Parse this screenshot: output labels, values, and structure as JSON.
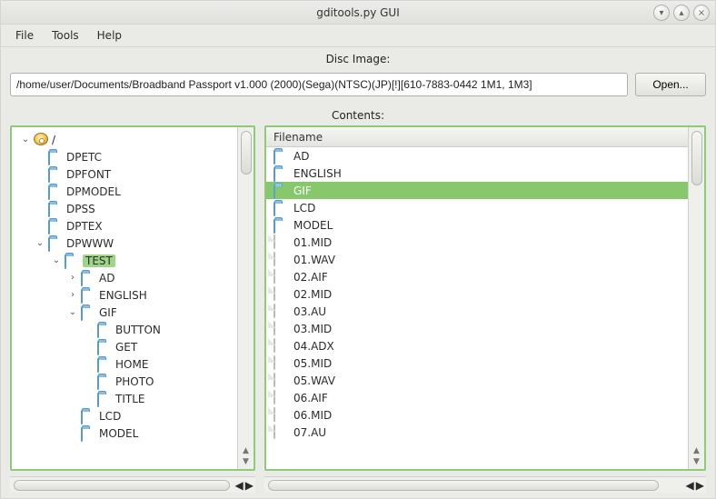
{
  "window": {
    "title": "gditools.py GUI"
  },
  "menus": {
    "file": "File",
    "tools": "Tools",
    "help": "Help"
  },
  "disc": {
    "label": "Disc Image:",
    "value": "/home/user/Documents/Broadband Passport v1.000 (2000)(Sega)(NTSC)(JP)[!][610-7883-0442 1M1, 1M3]",
    "open": "Open..."
  },
  "contents": {
    "label": "Contents:",
    "column": "Filename"
  },
  "tree": {
    "root": "/",
    "items": [
      {
        "name": "DPETC",
        "depth": 1,
        "exp": ""
      },
      {
        "name": "DPFONT",
        "depth": 1,
        "exp": ""
      },
      {
        "name": "DPMODEL",
        "depth": 1,
        "exp": ""
      },
      {
        "name": "DPSS",
        "depth": 1,
        "exp": ""
      },
      {
        "name": "DPTEX",
        "depth": 1,
        "exp": ""
      },
      {
        "name": "DPWWW",
        "depth": 1,
        "exp": "v"
      },
      {
        "name": "TEST",
        "depth": 2,
        "exp": "v",
        "selected": true
      },
      {
        "name": "AD",
        "depth": 3,
        "exp": ">"
      },
      {
        "name": "ENGLISH",
        "depth": 3,
        "exp": ">"
      },
      {
        "name": "GIF",
        "depth": 3,
        "exp": "v"
      },
      {
        "name": "BUTTON",
        "depth": 4,
        "exp": ""
      },
      {
        "name": "GET",
        "depth": 4,
        "exp": ""
      },
      {
        "name": "HOME",
        "depth": 4,
        "exp": ""
      },
      {
        "name": "PHOTO",
        "depth": 4,
        "exp": ""
      },
      {
        "name": "TITLE",
        "depth": 4,
        "exp": ""
      },
      {
        "name": "LCD",
        "depth": 3,
        "exp": ""
      },
      {
        "name": "MODEL",
        "depth": 3,
        "exp": ""
      }
    ]
  },
  "list": {
    "rows": [
      {
        "name": "AD",
        "type": "folder"
      },
      {
        "name": "ENGLISH",
        "type": "folder"
      },
      {
        "name": "GIF",
        "type": "folder",
        "selected": true
      },
      {
        "name": "LCD",
        "type": "folder"
      },
      {
        "name": "MODEL",
        "type": "folder"
      },
      {
        "name": "01.MID",
        "type": "file"
      },
      {
        "name": "01.WAV",
        "type": "file"
      },
      {
        "name": "02.AIF",
        "type": "file"
      },
      {
        "name": "02.MID",
        "type": "file"
      },
      {
        "name": "03.AU",
        "type": "file"
      },
      {
        "name": "03.MID",
        "type": "file"
      },
      {
        "name": "04.ADX",
        "type": "file"
      },
      {
        "name": "05.MID",
        "type": "file"
      },
      {
        "name": "05.WAV",
        "type": "file"
      },
      {
        "name": "06.AIF",
        "type": "file"
      },
      {
        "name": "06.MID",
        "type": "file"
      },
      {
        "name": "07.AU",
        "type": "file"
      }
    ]
  }
}
